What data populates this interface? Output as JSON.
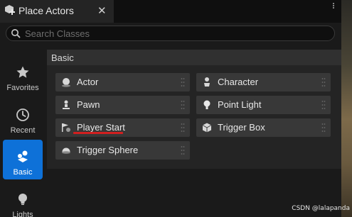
{
  "tab": {
    "title": "Place Actors",
    "close_symbol": "✕"
  },
  "search": {
    "placeholder": "Search Classes",
    "value": ""
  },
  "nav": {
    "items": [
      {
        "label": "Favorites",
        "icon": "star-icon"
      },
      {
        "label": "Recent",
        "icon": "clock-icon"
      },
      {
        "label": "Basic",
        "icon": "shapes-icon",
        "active": true
      },
      {
        "label": "Lights",
        "icon": "lightbulb-icon"
      }
    ]
  },
  "section": {
    "title": "Basic"
  },
  "actors": [
    {
      "label": "Actor",
      "icon": "sphere-icon"
    },
    {
      "label": "Character",
      "icon": "character-icon"
    },
    {
      "label": "Pawn",
      "icon": "pawn-icon"
    },
    {
      "label": "Point Light",
      "icon": "point-light-icon"
    },
    {
      "label": "Player Start",
      "icon": "player-start-icon"
    },
    {
      "label": "Trigger Box",
      "icon": "trigger-box-icon"
    },
    {
      "label": "Trigger Sphere",
      "icon": "trigger-sphere-icon"
    }
  ],
  "colors": {
    "accent": "#0e71d8",
    "underline": "#d11f1f",
    "panel": "#242424",
    "item": "#383838"
  },
  "watermark": "CSDN @lalapanda"
}
